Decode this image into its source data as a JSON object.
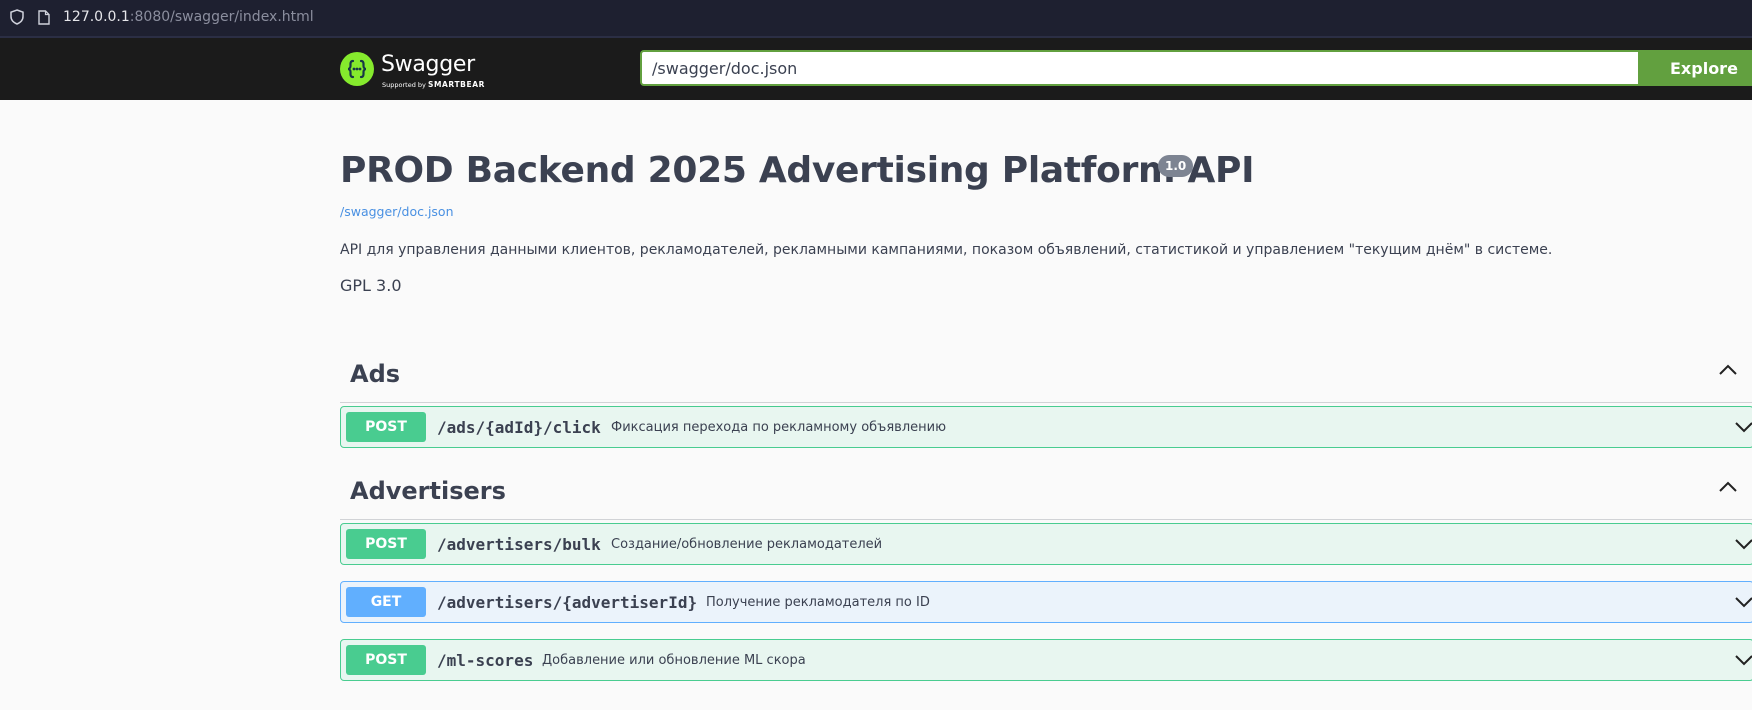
{
  "browser": {
    "url_host": "127.0.0.1",
    "url_rest": ":8080/swagger/index.html"
  },
  "header": {
    "brand": "Swagger",
    "supported_by": "Supported by",
    "smartbear": "SMARTBEAR",
    "spec_url_value": "/swagger/doc.json",
    "explore_label": "Explore"
  },
  "info": {
    "title": "PROD Backend 2025 Advertising Platform API",
    "version": "1.0",
    "spec_link": "/swagger/doc.json",
    "description": "API для управления данными клиентов, рекламодателей, рекламными кампаниями, показом объявлений, статистикой и управлением \"текущим днём\" в системе.",
    "license": "GPL 3.0"
  },
  "tags": [
    {
      "name": "Ads",
      "operations": [
        {
          "method": "POST",
          "path": "/ads/{adId}/click",
          "summary": "Фиксация перехода по рекламному объявлению"
        }
      ]
    },
    {
      "name": "Advertisers",
      "operations": [
        {
          "method": "POST",
          "path": "/advertisers/bulk",
          "summary": "Создание/обновление рекламодателей"
        },
        {
          "method": "GET",
          "path": "/advertisers/{advertiserId}",
          "summary": "Получение рекламодателя по ID"
        },
        {
          "method": "POST",
          "path": "/ml-scores",
          "summary": "Добавление или обновление ML скора"
        }
      ]
    }
  ],
  "colors": {
    "post": "#49cc90",
    "get": "#61affe",
    "swagger_green": "#85ea2d",
    "explore_green": "#62a03f"
  },
  "icons": {
    "browser_security": "shield-icon",
    "browser_page": "page-icon",
    "logo": "swagger-logo-icon",
    "tag_toggle": "chevron-up-icon",
    "operation_toggle": "chevron-down-icon"
  }
}
